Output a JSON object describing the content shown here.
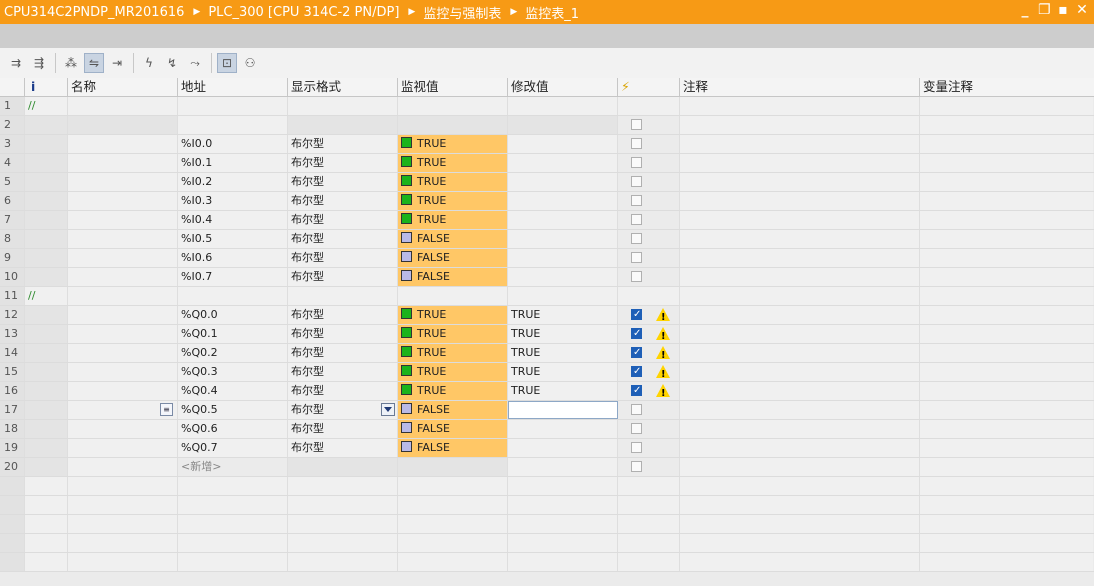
{
  "breadcrumb": [
    "CPU314C2PNDP_MR201616",
    "PLC_300 [CPU 314C-2 PN/DP]",
    "监控与强制表",
    "监控表_1"
  ],
  "window_controls": [
    "minimize",
    "restore",
    "maximize",
    "close"
  ],
  "toolbar": {
    "buttons": [
      "insert-row",
      "add-row",
      "update-once",
      "monitor-all",
      "monitor-once",
      "modify-now",
      "modify-trigger",
      "enable-peripheral",
      "show-modify-columns",
      "show-all-modify"
    ]
  },
  "columns": [
    "",
    "i",
    "名称",
    "地址",
    "显示格式",
    "监视值",
    "修改值",
    "⚡",
    "注释",
    "变量注释"
  ],
  "rows": [
    {
      "n": "1",
      "type": "comment",
      "comment": "//"
    },
    {
      "n": "2",
      "type": "empty",
      "address": "",
      "format": "",
      "monitor": "",
      "modify": ""
    },
    {
      "n": "3",
      "type": "data",
      "address": "%I0.0",
      "format": "布尔型",
      "monitor": "TRUE",
      "state": "true",
      "modify": "",
      "force": false,
      "warn": false
    },
    {
      "n": "4",
      "type": "data",
      "address": "%I0.1",
      "format": "布尔型",
      "monitor": "TRUE",
      "state": "true",
      "modify": "",
      "force": false,
      "warn": false
    },
    {
      "n": "5",
      "type": "data",
      "address": "%I0.2",
      "format": "布尔型",
      "monitor": "TRUE",
      "state": "true",
      "modify": "",
      "force": false,
      "warn": false
    },
    {
      "n": "6",
      "type": "data",
      "address": "%I0.3",
      "format": "布尔型",
      "monitor": "TRUE",
      "state": "true",
      "modify": "",
      "force": false,
      "warn": false
    },
    {
      "n": "7",
      "type": "data",
      "address": "%I0.4",
      "format": "布尔型",
      "monitor": "TRUE",
      "state": "true",
      "modify": "",
      "force": false,
      "warn": false
    },
    {
      "n": "8",
      "type": "data",
      "address": "%I0.5",
      "format": "布尔型",
      "monitor": "FALSE",
      "state": "false",
      "modify": "",
      "force": false,
      "warn": false
    },
    {
      "n": "9",
      "type": "data",
      "address": "%I0.6",
      "format": "布尔型",
      "monitor": "FALSE",
      "state": "false",
      "modify": "",
      "force": false,
      "warn": false
    },
    {
      "n": "10",
      "type": "data",
      "address": "%I0.7",
      "format": "布尔型",
      "monitor": "FALSE",
      "state": "false",
      "modify": "",
      "force": false,
      "warn": false
    },
    {
      "n": "11",
      "type": "comment",
      "comment": "//"
    },
    {
      "n": "12",
      "type": "data",
      "address": "%Q0.0",
      "format": "布尔型",
      "monitor": "TRUE",
      "state": "true",
      "modify": "TRUE",
      "force": true,
      "warn": true
    },
    {
      "n": "13",
      "type": "data",
      "address": "%Q0.1",
      "format": "布尔型",
      "monitor": "TRUE",
      "state": "true",
      "modify": "TRUE",
      "force": true,
      "warn": true
    },
    {
      "n": "14",
      "type": "data",
      "address": "%Q0.2",
      "format": "布尔型",
      "monitor": "TRUE",
      "state": "true",
      "modify": "TRUE",
      "force": true,
      "warn": true
    },
    {
      "n": "15",
      "type": "data",
      "address": "%Q0.3",
      "format": "布尔型",
      "monitor": "TRUE",
      "state": "true",
      "modify": "TRUE",
      "force": true,
      "warn": true
    },
    {
      "n": "16",
      "type": "data",
      "address": "%Q0.4",
      "format": "布尔型",
      "monitor": "TRUE",
      "state": "true",
      "modify": "TRUE",
      "force": true,
      "warn": true
    },
    {
      "n": "17",
      "type": "data",
      "address": "%Q0.5",
      "format": "布尔型",
      "monitor": "FALSE",
      "state": "false",
      "modify": "",
      "force": false,
      "warn": false,
      "selected": true
    },
    {
      "n": "18",
      "type": "data",
      "address": "%Q0.6",
      "format": "布尔型",
      "monitor": "FALSE",
      "state": "false",
      "modify": "",
      "force": false,
      "warn": false
    },
    {
      "n": "19",
      "type": "data",
      "address": "%Q0.7",
      "format": "布尔型",
      "monitor": "FALSE",
      "state": "false",
      "modify": "",
      "force": false,
      "warn": false
    },
    {
      "n": "20",
      "type": "new",
      "address": "<新增>"
    }
  ],
  "colors": {
    "title_bg": "#f79a15",
    "monitor_bg": "#ffc766",
    "true_square": "#1bb31b",
    "false_square": "#b9b9e6"
  }
}
